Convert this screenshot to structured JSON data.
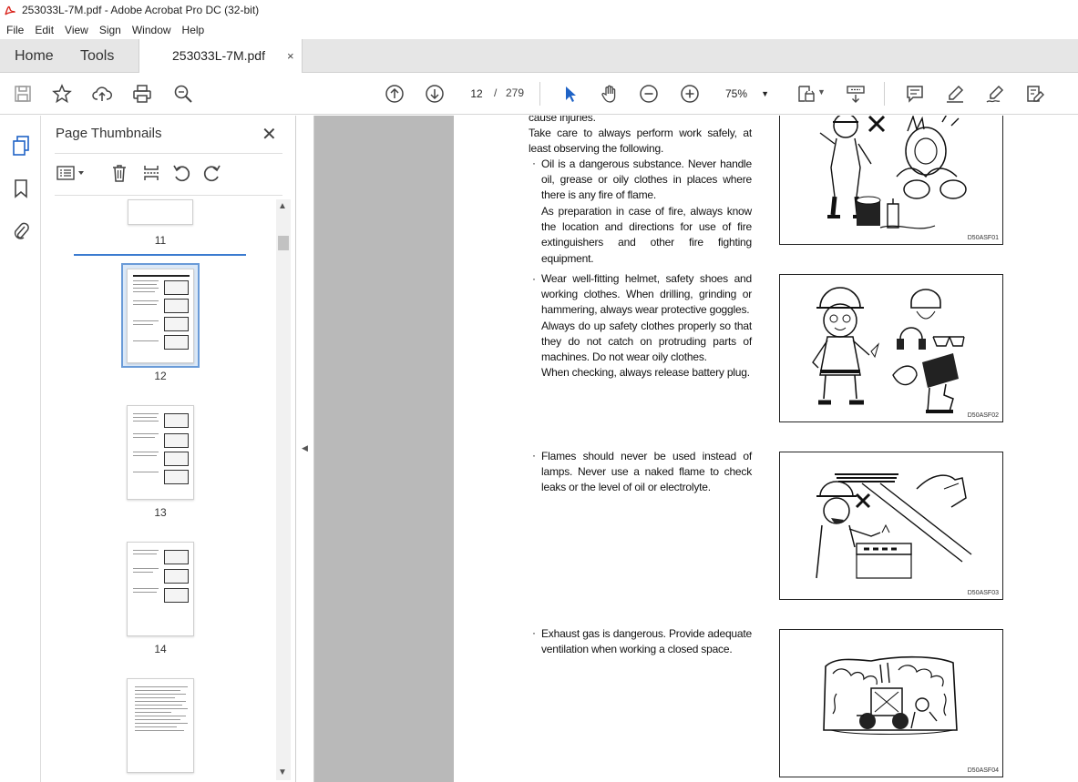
{
  "window": {
    "title": "253033L-7M.pdf - Adobe Acrobat Pro DC (32-bit)"
  },
  "menu": [
    "File",
    "Edit",
    "View",
    "Sign",
    "Window",
    "Help"
  ],
  "tabs": {
    "home": "Home",
    "tools": "Tools",
    "document": "253033L-7M.pdf",
    "close_glyph": "×"
  },
  "toolbar": {
    "page_current": "12",
    "page_separator": "/",
    "page_total": "279",
    "zoom": "75%"
  },
  "panel": {
    "title": "Page Thumbnails",
    "close_glyph": "✕"
  },
  "thumbnails": [
    {
      "label": "11"
    },
    {
      "label": "12"
    },
    {
      "label": "13"
    },
    {
      "label": "14"
    }
  ],
  "document": {
    "paragraphs": {
      "p0a": "cause injuries.",
      "p0b": "Take care to always perform work safely, at least observing the following.",
      "p1": "Oil is a dangerous substance.   Never handle oil, grease or oily clothes in places where there is any fire of flame.",
      "p1b": "As preparation in case of fire, always know the location and directions for use of fire extinguishers and other fire fighting equipment.",
      "p2": "Wear well-fitting helmet, safety shoes and working clothes.   When drilling, grinding or hammering, always wear protective goggles.",
      "p2b": "Always do up safety clothes properly so that they do not catch on protruding parts of machines.   Do not wear oily clothes.",
      "p2c": "When checking, always release battery plug.",
      "p3": "Flames should never be used instead of lamps.   Never use a naked flame to check leaks or the level of oil or electrolyte.",
      "p4": "Exhaust gas is dangerous.  Provide adequate ventilation when working a closed space."
    },
    "bullet_glyph": "·",
    "figures": [
      {
        "caption": "D50ASF01"
      },
      {
        "caption": "D50ASF02"
      },
      {
        "caption": "D50ASF03"
      },
      {
        "caption": "D50ASF04"
      }
    ]
  }
}
